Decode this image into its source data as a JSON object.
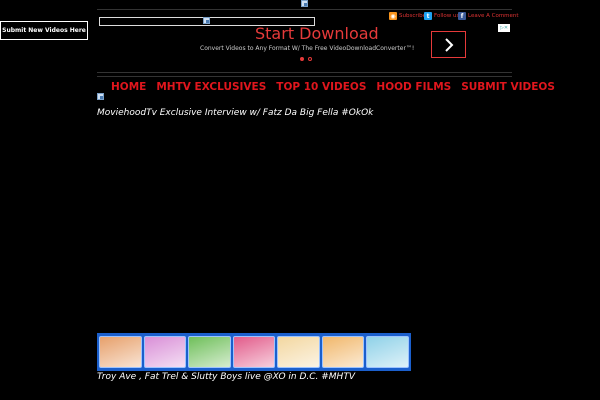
{
  "sidebar": {
    "submit_new_label": "Submit New Videos Here"
  },
  "header": {
    "social": [
      {
        "label": "Subscribe",
        "icon": "rss-icon",
        "color": "#f7941d"
      },
      {
        "label": "Follow us",
        "icon": "twitter-icon",
        "color": "#1da1f2"
      },
      {
        "label": "Leave A Comment",
        "icon": "facebook-icon",
        "color": "#3b5998"
      }
    ]
  },
  "ad": {
    "title": "Start Download",
    "subtitle": "Convert Videos to Any Format W/ The Free VideoDownloadConverter™!",
    "accent": "#e63a3a"
  },
  "nav": {
    "items": [
      "HOME",
      "MHTV EXCLUSIVES",
      "TOP 10 VIDEOS",
      "HOOD FILMS",
      "SUBMIT VIDEOS"
    ],
    "color": "#e0161d"
  },
  "posts": [
    {
      "title": "MoviehoodTv Exclusive Interview w/ Fatz Da Big Fella #OkOk"
    },
    {
      "title": "Troy Ave , Fat Trel & Slutty Boys live @XO in D.C. #MHTV"
    }
  ],
  "games_strip": {
    "thumb_colors": [
      "#e7a06b",
      "#d98fd7",
      "#6fbf5a",
      "#e25b8a",
      "#f3d7a0",
      "#f1b76b",
      "#8fd1e8",
      "#f5c646"
    ]
  }
}
